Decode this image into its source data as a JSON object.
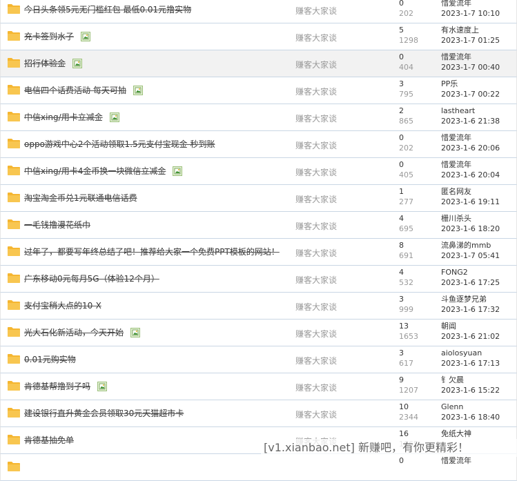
{
  "threads": [
    {
      "title": "今日头条领5元无门槛红包 最低0.01元撸实物",
      "has_image": false,
      "forum": "赚客大家谈",
      "replies": "0",
      "views": "202",
      "last_author": "惜爱流年",
      "last_date": "2023-1-7 10:10"
    },
    {
      "title": "充卡签到水子",
      "has_image": true,
      "forum": "赚客大家谈",
      "replies": "5",
      "views": "1298",
      "last_author": "有水速度上",
      "last_date": "2023-1-7 01:25"
    },
    {
      "title": "招行体验金",
      "has_image": true,
      "forum": "赚客大家谈",
      "replies": "0",
      "views": "404",
      "last_author": "惜爱流年",
      "last_date": "2023-1-7 00:40"
    },
    {
      "title": "电信四个话费活动 每天可抽",
      "has_image": true,
      "forum": "赚客大家谈",
      "replies": "3",
      "views": "795",
      "last_author": "PP乐",
      "last_date": "2023-1-7 00:22"
    },
    {
      "title": "中信xing/用卡立减金",
      "has_image": true,
      "forum": "赚客大家谈",
      "replies": "2",
      "views": "865",
      "last_author": "lastheart",
      "last_date": "2023-1-6 21:38"
    },
    {
      "title": "oppo游戏中心2个活动领取1.5元支付宝现金 秒到账",
      "has_image": false,
      "forum": "赚客大家谈",
      "replies": "0",
      "views": "202",
      "last_author": "惜爱流年",
      "last_date": "2023-1-6 20:06"
    },
    {
      "title": "中信xing/用卡4金币换一块微信立减金",
      "has_image": true,
      "forum": "赚客大家谈",
      "replies": "0",
      "views": "405",
      "last_author": "惜爱流年",
      "last_date": "2023-1-6 20:04"
    },
    {
      "title": "淘宝淘金币兑1元联通电信话费",
      "has_image": false,
      "forum": "赚客大家谈",
      "replies": "1",
      "views": "277",
      "last_author": "匿名网友",
      "last_date": "2023-1-6 19:11"
    },
    {
      "title": "一毛钱撸漫花纸巾",
      "has_image": false,
      "forum": "赚客大家谈",
      "replies": "4",
      "views": "695",
      "last_author": "栅川杀头",
      "last_date": "2023-1-6 18:20"
    },
    {
      "title": "过年了，都要写年终总结了吧！推荐给大家一个免费PPT模板的网站！",
      "has_image": false,
      "forum": "赚客大家谈",
      "replies": "8",
      "views": "691",
      "last_author": "流鼻涕的mmb",
      "last_date": "2023-1-7 05:41"
    },
    {
      "title": "广东移动0元每月5G（体验12个月）",
      "has_image": false,
      "forum": "赚客大家谈",
      "replies": "4",
      "views": "532",
      "last_author": "FONG2",
      "last_date": "2023-1-6 17:25"
    },
    {
      "title": "支付宝稍大点的10-X",
      "has_image": false,
      "forum": "赚客大家谈",
      "replies": "3",
      "views": "999",
      "last_author": "斗鱼逐梦兄弟",
      "last_date": "2023-1-6 17:32"
    },
    {
      "title": "光大石化新活动，今天开始",
      "has_image": true,
      "forum": "赚客大家谈",
      "replies": "13",
      "views": "1653",
      "last_author": "朝阊",
      "last_date": "2023-1-6 21:02"
    },
    {
      "title": "0.01元购实物",
      "has_image": false,
      "forum": "赚客大家谈",
      "replies": "3",
      "views": "617",
      "last_author": "aiolosyuan",
      "last_date": "2023-1-6 17:13"
    },
    {
      "title": "肯德基帮撸到子吗",
      "has_image": true,
      "forum": "赚客大家谈",
      "replies": "9",
      "views": "1207",
      "last_author": "钅欠晨",
      "last_date": "2023-1-6 15:22"
    },
    {
      "title": "建设银行直升黄金会员领取30元天猫超市卡",
      "has_image": false,
      "forum": "赚客大家谈",
      "replies": "10",
      "views": "2344",
      "last_author": "Glenn",
      "last_date": "2023-1-6 18:40"
    },
    {
      "title": "肯德基抽免单",
      "has_image": false,
      "forum": "赚客大家谈",
      "replies": "16",
      "views": "1665",
      "last_author": "免纸大神",
      "last_date": ""
    },
    {
      "title": "",
      "has_image": false,
      "forum": "",
      "replies": "0",
      "views": "",
      "last_author": "惜爱流年",
      "last_date": ""
    }
  ],
  "highlighted_row": 2,
  "watermark": "[v1.xianbao.net] 新赚吧，有你更精彩！",
  "colors": {
    "folder": "#f5b631",
    "row_border": "#c9d6e4",
    "highlight": "#f2f2f2",
    "muted": "#999999"
  },
  "icons": {
    "row_icon": "folder-icon",
    "attachment_icon": "image-attachment-icon"
  }
}
